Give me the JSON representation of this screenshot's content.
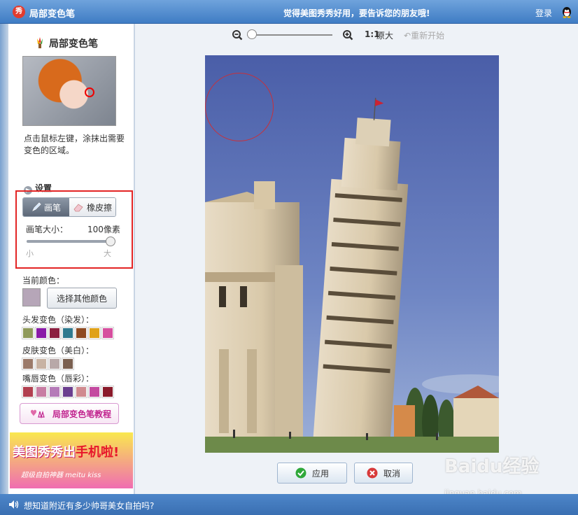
{
  "titlebar": {
    "app_title": "局部变色笔",
    "logo_text": "秀",
    "promo": "觉得美图秀秀好用，要告诉您的朋友哦!",
    "login": "登录"
  },
  "left_panel": {
    "heading": "局部变色笔",
    "instructions": "点击鼠标左键，涂抹出需要变色的区域。",
    "settings_label": "设置",
    "tools": {
      "brush": "画笔",
      "eraser": "橡皮擦",
      "active": "brush"
    },
    "brush_size": {
      "label": "画笔大小：",
      "value_text": "100像素",
      "value_fraction": 1.0,
      "min_label": "小",
      "max_label": "大"
    },
    "current_color": {
      "label": "当前颜色：",
      "color": "#b6a6b8"
    },
    "choose_color_button": "选择其他颜色",
    "color_groups": [
      {
        "label": "头发变色（染发）：",
        "colors": [
          "#8f9a5a",
          "#8a1aa8",
          "#8c2040",
          "#2f7a8f",
          "#8e4a22",
          "#e0a21a",
          "#d64f9e"
        ]
      },
      {
        "label": "皮肤变色（美白）：",
        "colors": [
          "#9b7a6a",
          "#c8b3a3",
          "#b8a8a8",
          "#7a6050"
        ]
      },
      {
        "label": "嘴唇变色（唇彩）：",
        "colors": [
          "#b24050",
          "#c87da3",
          "#b57ab8",
          "#6b3f8f",
          "#d08a8f",
          "#c44aa0",
          "#8a1a2a"
        ]
      }
    ],
    "tutorial_button": "局部变色笔教程",
    "ad": {
      "main_left": "美图秀秀出",
      "main_right": "手机啦!",
      "sub": "超级自拍神器 meitu kiss"
    }
  },
  "workspace": {
    "ratio_label": "1:1",
    "original_label": "原大",
    "restart_label": "重新开始",
    "zoom_fraction": 0.0,
    "apply_button": "应用",
    "cancel_button": "取消",
    "watermark": "Baidu经验",
    "watermark_url": "jingyan.baidu.com"
  },
  "statusbar": {
    "text": "想知道附近有多少帅哥美女自拍吗?"
  },
  "colors": {
    "title_blue": "#3f7cc4",
    "selection_red": "#e32424",
    "apply_green": "#2fa83a",
    "cancel_red": "#d83a3a"
  }
}
